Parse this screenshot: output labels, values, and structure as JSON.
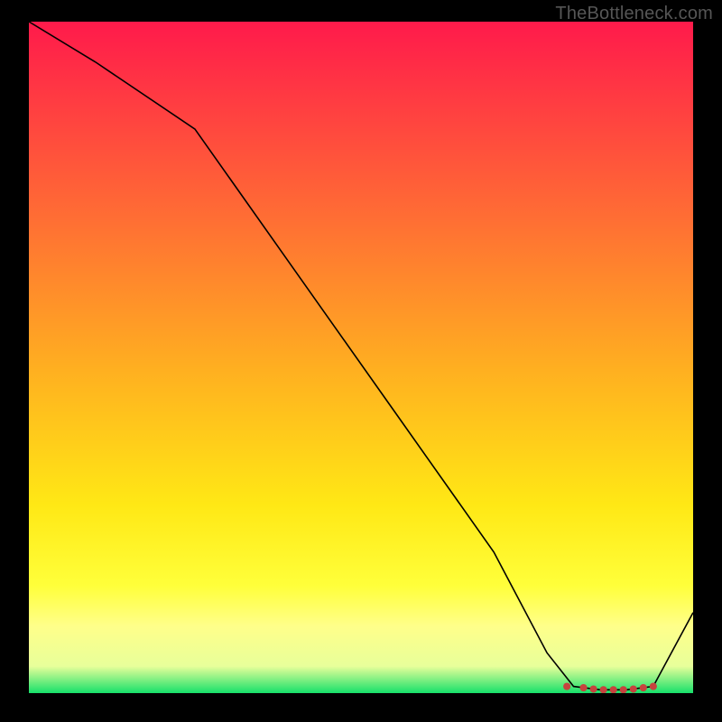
{
  "attribution": "TheBottleneck.com",
  "colors": {
    "bg": "#000000",
    "top": "#ff1a4b",
    "mid1": "#ff6a35",
    "mid2": "#ffb020",
    "mid3": "#ffe815",
    "band": "#ffff8a",
    "green": "#16e06a",
    "line": "#000000",
    "marker": "#c7433e"
  },
  "chart_data": {
    "type": "line",
    "title": "",
    "xlabel": "",
    "ylabel": "",
    "xlim": [
      0,
      100
    ],
    "ylim": [
      0,
      100
    ],
    "x": [
      0,
      10,
      25,
      40,
      55,
      70,
      78,
      82,
      86,
      90,
      94,
      100
    ],
    "values": [
      100,
      94,
      84,
      63,
      42,
      21,
      6,
      1,
      0.5,
      0.5,
      1,
      12
    ],
    "markers_x": [
      81,
      83.5,
      85,
      86.5,
      88,
      89.5,
      91,
      92.5,
      94
    ],
    "markers_y": [
      1.0,
      0.8,
      0.6,
      0.5,
      0.5,
      0.5,
      0.6,
      0.8,
      1.0
    ]
  }
}
